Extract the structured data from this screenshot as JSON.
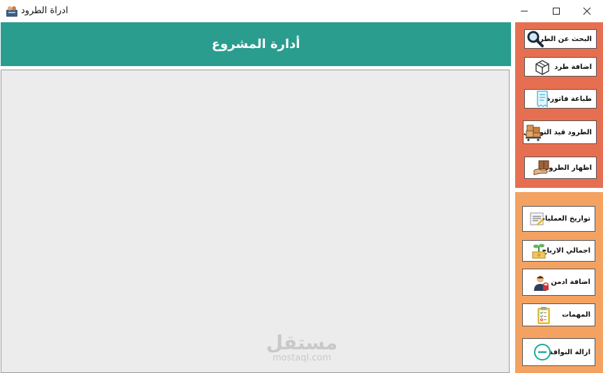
{
  "window": {
    "title": "ادراة الطرود",
    "controls": [
      "minimize-icon",
      "maximize-icon",
      "close-icon"
    ]
  },
  "header": {
    "title": "أدارة المشروع"
  },
  "colors": {
    "header_bg": "#2a9d8f",
    "panel_top_bg": "#e76f51",
    "panel_bottom_bg": "#f4a261",
    "content_bg": "#ececec"
  },
  "sidebar": {
    "top_buttons": [
      {
        "label": "البحث عن الطرد",
        "icon": "magnifier-icon"
      },
      {
        "label": "اضافة طرد",
        "icon": "box-icon"
      },
      {
        "label": "طباعة فاتورة",
        "icon": "receipt-icon"
      },
      {
        "label": "الطرود قيد التوصيل",
        "icon": "boxes-cart-icon"
      },
      {
        "label": "اظهار الطرود",
        "icon": "box-hand-icon"
      }
    ],
    "bottom_buttons": [
      {
        "label": "تواريخ العمليات",
        "icon": "document-icon"
      },
      {
        "label": "اجمالي الارباح",
        "icon": "plant-money-icon"
      },
      {
        "label": "اضافة ادمن",
        "icon": "admin-user-icon"
      },
      {
        "label": "المهمات",
        "icon": "clipboard-icon"
      },
      {
        "label": "ازالة النوافذ",
        "icon": "minus-circle-icon"
      }
    ]
  },
  "watermark": {
    "arabic": "مستقل",
    "latin": "mostaql.com"
  }
}
